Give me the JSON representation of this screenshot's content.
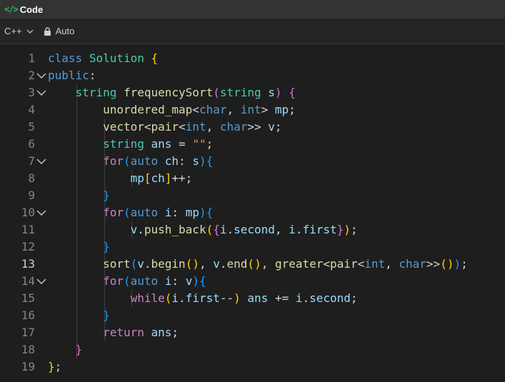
{
  "header": {
    "icon": "</>",
    "title": "Code"
  },
  "toolbar": {
    "language": "C++",
    "mode": "Auto"
  },
  "editor": {
    "current_line": 13,
    "lines": [
      {
        "n": "1",
        "code": "class Solution {",
        "fold": false
      },
      {
        "n": "2",
        "code": "public:",
        "fold": true
      },
      {
        "n": "3",
        "code": "    string frequencySort(string s) {",
        "fold": true
      },
      {
        "n": "4",
        "code": "        unordered_map<char, int> mp;",
        "fold": false
      },
      {
        "n": "5",
        "code": "        vector<pair<int, char>> v;",
        "fold": false
      },
      {
        "n": "6",
        "code": "        string ans = \"\";",
        "fold": false
      },
      {
        "n": "7",
        "code": "        for(auto ch: s){",
        "fold": true
      },
      {
        "n": "8",
        "code": "            mp[ch]++;",
        "fold": false
      },
      {
        "n": "9",
        "code": "        }",
        "fold": false
      },
      {
        "n": "10",
        "code": "        for(auto i: mp){",
        "fold": true
      },
      {
        "n": "11",
        "code": "            v.push_back({i.second, i.first});",
        "fold": false
      },
      {
        "n": "12",
        "code": "        }",
        "fold": false
      },
      {
        "n": "13",
        "code": "        sort(v.begin(), v.end(), greater<pair<int, char>>());",
        "fold": false
      },
      {
        "n": "14",
        "code": "        for(auto i: v){",
        "fold": true
      },
      {
        "n": "15",
        "code": "            while(i.first--) ans += i.second;",
        "fold": false
      },
      {
        "n": "16",
        "code": "        }",
        "fold": false
      },
      {
        "n": "17",
        "code": "        return ans;",
        "fold": false
      },
      {
        "n": "18",
        "code": "    }",
        "fold": false
      },
      {
        "n": "19",
        "code": "};",
        "fold": false
      }
    ]
  },
  "colors": {
    "accent": "#2cbb5d",
    "keyword": "#569cd6",
    "type": "#4ec9b0",
    "function": "#dcdcaa",
    "control": "#c586c0",
    "variable": "#9cdcfe",
    "string": "#ce9178"
  }
}
